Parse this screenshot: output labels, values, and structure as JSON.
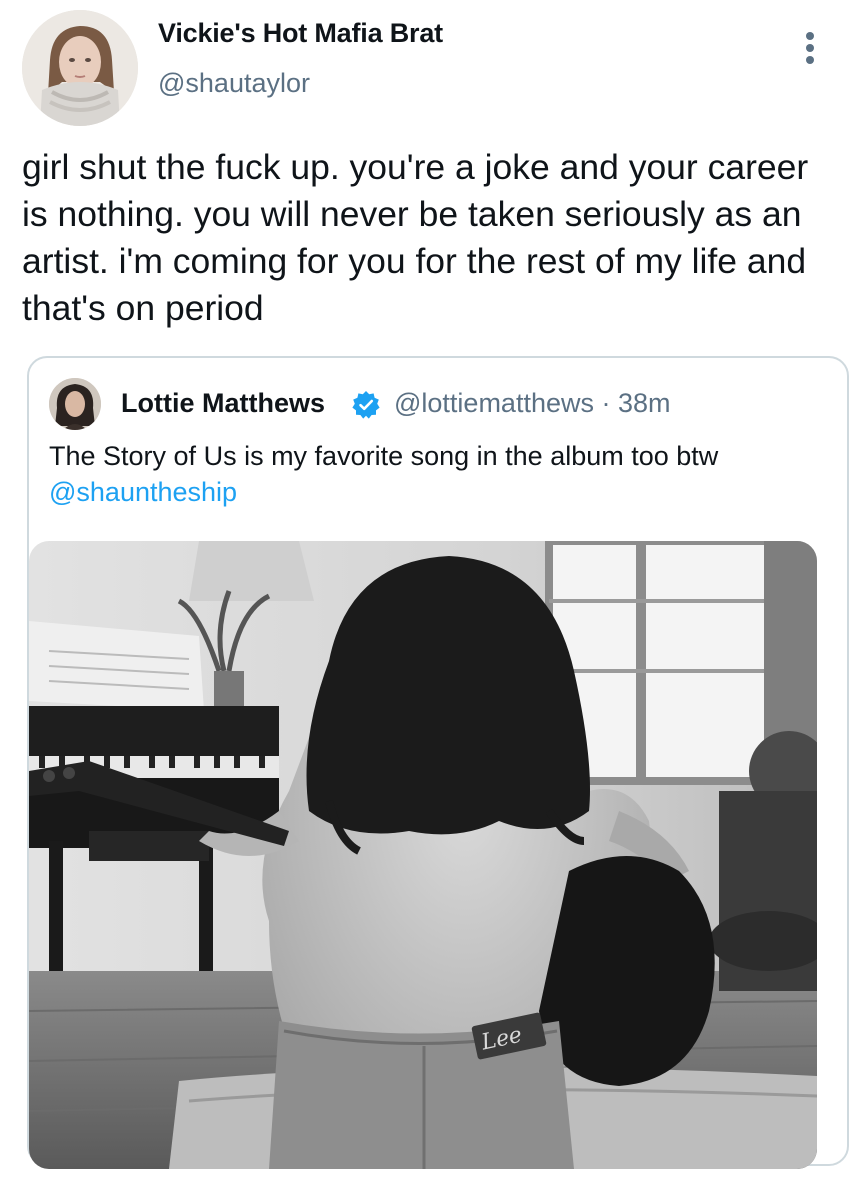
{
  "tweet": {
    "display_name": "Vickie's Hot Mafia Brat",
    "handle": "@shautaylor",
    "text": "girl shut the fuck up. you're a joke and your career is nothing. you will never be taken seriously as an artist. i'm coming for you for the rest of my life and that's on period",
    "more_icon": "more-vertical-icon"
  },
  "quoted": {
    "display_name": "Lottie Matthews",
    "verified_icon": "verified-badge-icon",
    "handle": "@lottiematthews",
    "separator": "·",
    "time": "38m",
    "text_main": "The Story of Us is my favorite song in the album too btw ",
    "mention": "@shauntheship",
    "media_logo_text": "Lee"
  },
  "colors": {
    "text": "#0f1419",
    "secondary": "#5b7083",
    "link": "#1da1f2",
    "verified": "#1da1f2",
    "border": "#cfd9de"
  }
}
